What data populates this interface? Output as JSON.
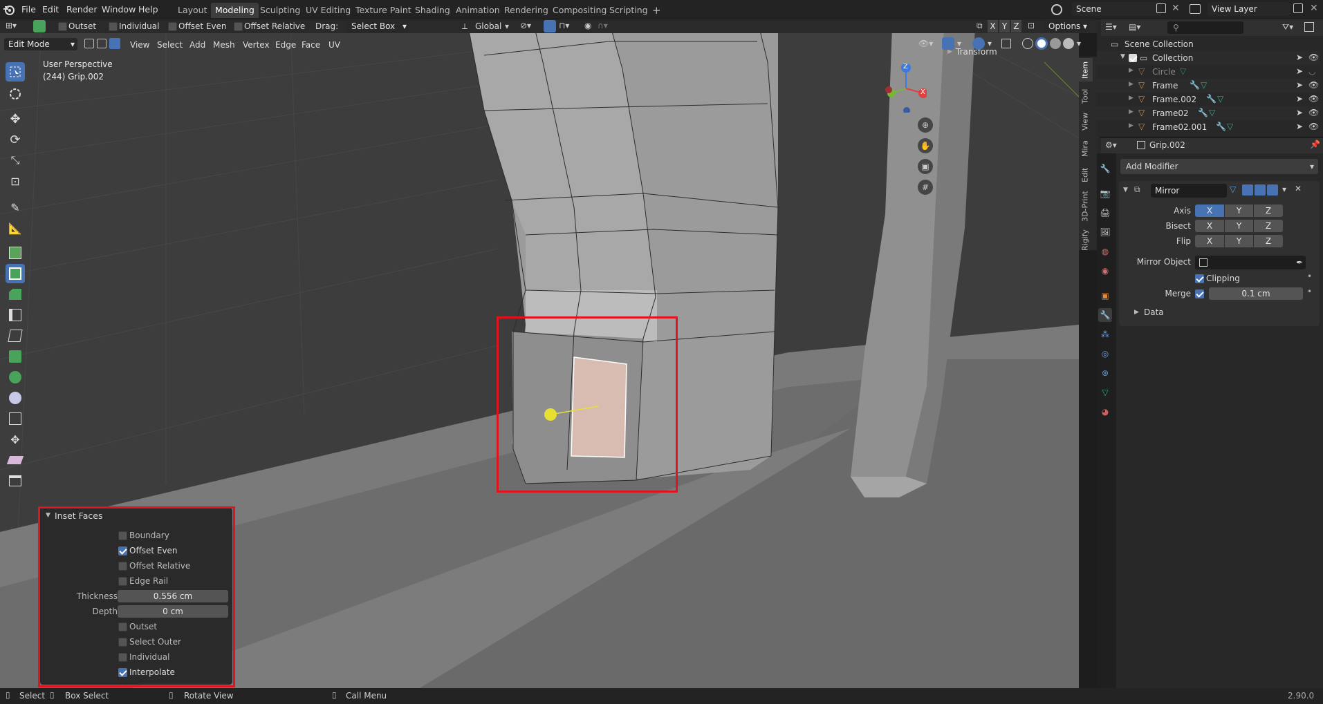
{
  "topbar": {
    "menus": [
      "File",
      "Edit",
      "Render",
      "Window",
      "Help"
    ],
    "workspaces": [
      "Layout",
      "Modeling",
      "Sculpting",
      "UV Editing",
      "Texture Paint",
      "Shading",
      "Animation",
      "Rendering",
      "Compositing",
      "Scripting"
    ],
    "active_workspace": "Modeling",
    "add_tab": "+",
    "scene": "Scene",
    "view_layer": "View Layer"
  },
  "tool_header": {
    "checks": [
      {
        "label": "Outset",
        "checked": false
      },
      {
        "label": "Individual",
        "checked": false
      },
      {
        "label": "Offset Even",
        "checked": false
      },
      {
        "label": "Offset Relative",
        "checked": false
      }
    ],
    "drag_label": "Drag:",
    "drag_value": "Select Box",
    "orientation": "Global",
    "axes": [
      "X",
      "Y",
      "Z"
    ],
    "options": "Options"
  },
  "viewport_header": {
    "mode": "Edit Mode",
    "menus": [
      "View",
      "Select",
      "Add",
      "Mesh",
      "Vertex",
      "Edge",
      "Face",
      "UV"
    ]
  },
  "viewport": {
    "perspective": "User Perspective",
    "object": "(244) Grip.002",
    "transform_panel": "Transform",
    "gizmo": {
      "x": "X",
      "y": "Y",
      "z": "Z"
    }
  },
  "side_tabs": [
    "Item",
    "Tool",
    "View",
    "Mira",
    "Edit",
    "3D-Print",
    "Rigify"
  ],
  "inset_panel": {
    "title": "Inset Faces",
    "boundary": {
      "label": "Boundary",
      "checked": false
    },
    "offset_even": {
      "label": "Offset Even",
      "checked": true
    },
    "offset_relative": {
      "label": "Offset Relative",
      "checked": false
    },
    "edge_rail": {
      "label": "Edge Rail",
      "checked": false
    },
    "thickness_label": "Thickness",
    "thickness_value": "0.556 cm",
    "depth_label": "Depth",
    "depth_value": "0 cm",
    "outset": {
      "label": "Outset",
      "checked": false
    },
    "select_outer": {
      "label": "Select Outer",
      "checked": false
    },
    "individual": {
      "label": "Individual",
      "checked": false
    },
    "interpolate": {
      "label": "Interpolate",
      "checked": true
    }
  },
  "outliner": {
    "root": "Scene Collection",
    "collection": "Collection",
    "items": [
      "Circle",
      "Frame",
      "Frame.002",
      "Frame02",
      "Frame02.001"
    ]
  },
  "properties": {
    "object_name": "Grip.002",
    "add_modifier": "Add Modifier",
    "modifier_name": "Mirror",
    "axis_label": "Axis",
    "bisect_label": "Bisect",
    "flip_label": "Flip",
    "xyz": [
      "X",
      "Y",
      "Z"
    ],
    "mirror_object_label": "Mirror Object",
    "clipping_label": "Clipping",
    "merge_label": "Merge",
    "merge_value": "0.1 cm",
    "data_label": "Data"
  },
  "statusbar": {
    "select": "Select",
    "box_select": "Box Select",
    "rotate_view": "Rotate View",
    "call_menu": "Call Menu",
    "version": "2.90.0"
  },
  "colors": {
    "accent": "#4772b3",
    "highlight": "#e0141e",
    "face_select": "#d9bcb1",
    "vertex": "#e8e030"
  }
}
